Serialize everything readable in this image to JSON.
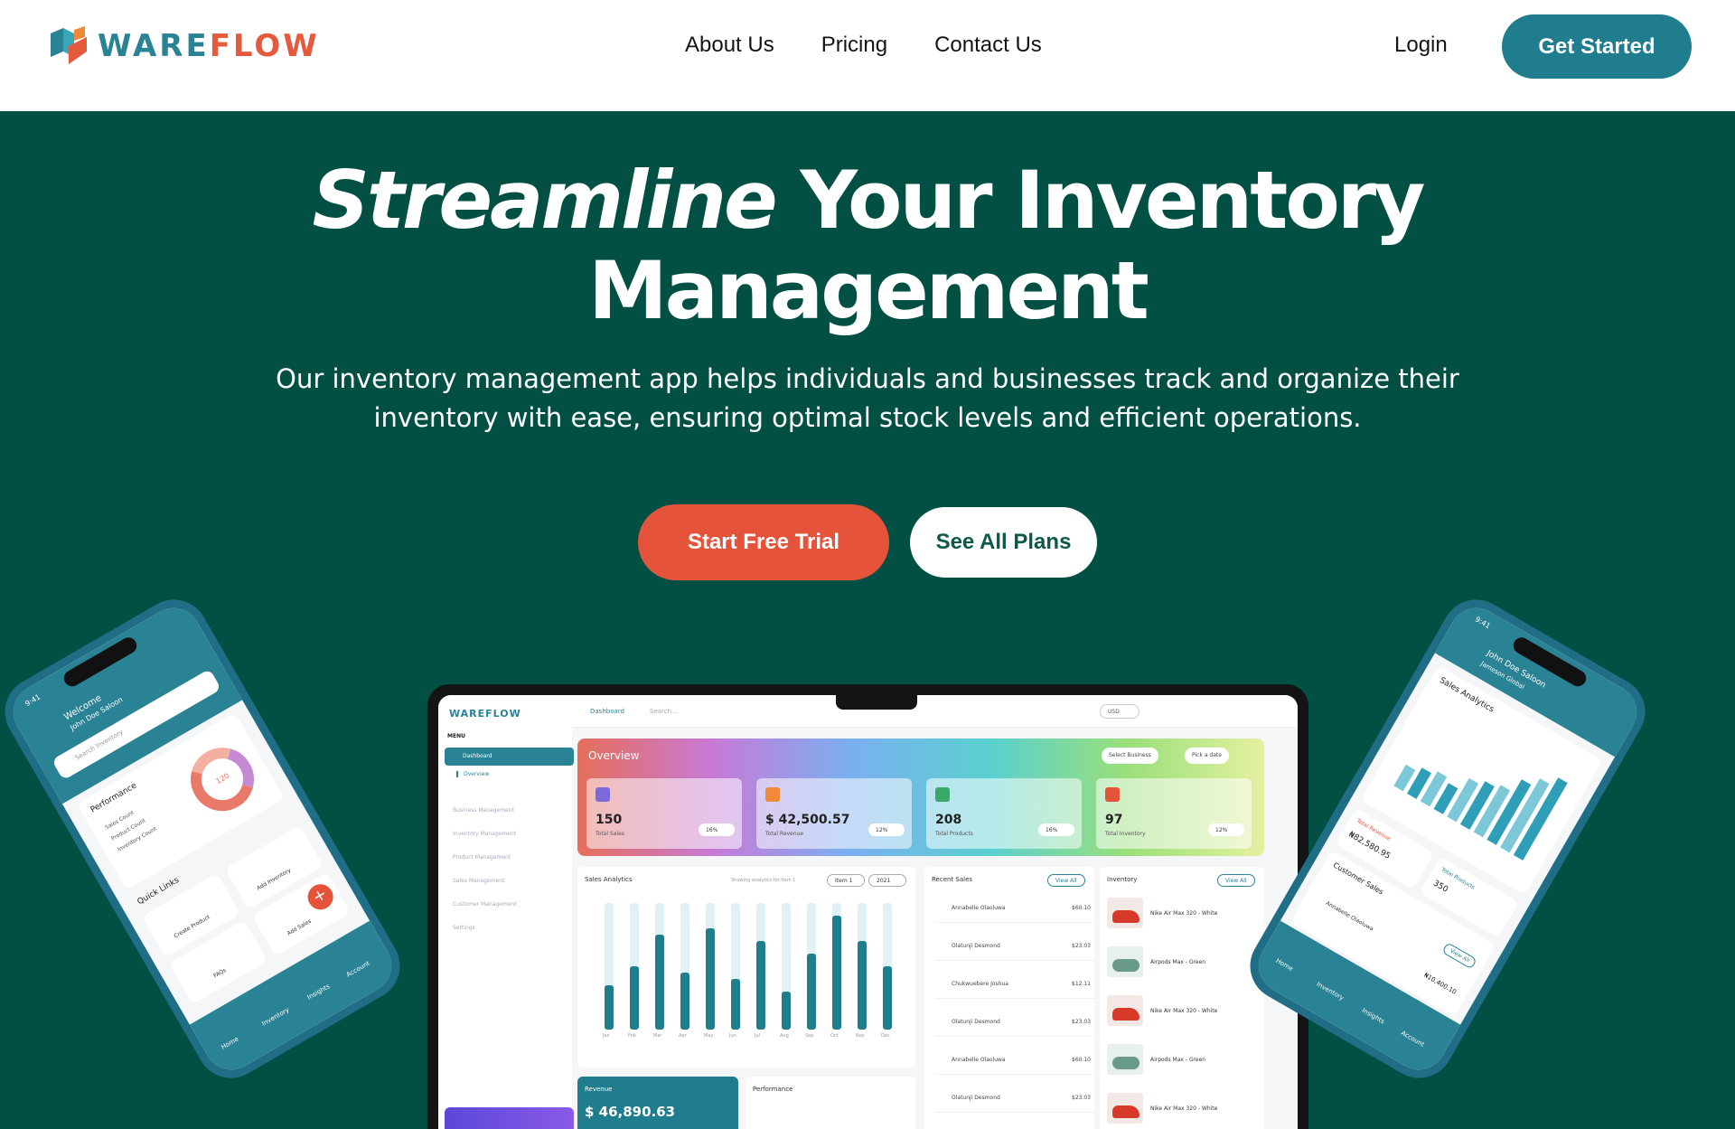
{
  "brand": {
    "part1": "WARE",
    "part2": "FLOW",
    "accent_teal": "#2a8295",
    "accent_orange": "#e55a3c"
  },
  "nav": {
    "links": [
      {
        "label": "About Us"
      },
      {
        "label": "Pricing"
      },
      {
        "label": "Contact Us"
      }
    ],
    "login": "Login",
    "cta": "Get Started"
  },
  "hero": {
    "title_italic": "Streamline",
    "title_rest": "Your Inventory",
    "title_line2": "Management",
    "subtitle": "Our inventory management app helps individuals and businesses track and organize their inventory with ease, ensuring optimal stock levels and efficient operations.",
    "primary_button": "Start Free Trial",
    "secondary_button": "See All Plans"
  },
  "dashboard": {
    "logo": "WAREFLOW",
    "menu_label": "MENU",
    "active_item": "Dashboard",
    "sub_item": "Overview",
    "sidebar_items": [
      "Business Management",
      "Inventory Management",
      "Product Management",
      "Sales Management",
      "Customer Management",
      "Settings"
    ],
    "breadcrumb": "Dashboard",
    "search_placeholder": "Search...",
    "currency": "USD",
    "overview_title": "Overview",
    "select_business": "Select Business",
    "pick_date": "Pick a date",
    "stats": [
      {
        "value": "150",
        "label": "Total Sales",
        "change": "16%",
        "color": "#7b6ad8"
      },
      {
        "value": "$ 42,500.57",
        "label": "Total Revenue",
        "change": "12%",
        "color": "#f08a3a"
      },
      {
        "value": "208",
        "label": "Total Products",
        "change": "16%",
        "color": "#3aa86a"
      },
      {
        "value": "97",
        "label": "Total Inventory",
        "change": "12%",
        "color": "#e5533a"
      }
    ],
    "sales_analytics_title": "Sales Analytics",
    "showing_analytics": "Showing analytics for Item 1",
    "item_select": "Item 1",
    "year_select": "2021",
    "months": [
      "Jan",
      "Feb",
      "Mar",
      "Apr",
      "May",
      "Jun",
      "Jul",
      "Aug",
      "Sep",
      "Oct",
      "Nov",
      "Dec"
    ],
    "bar_values": [
      0.35,
      0.5,
      0.75,
      0.45,
      0.8,
      0.4,
      0.7,
      0.3,
      0.6,
      0.9,
      0.7,
      0.5
    ],
    "recent_sales_title": "Recent Sales",
    "view_all": "View All",
    "recent_sales": [
      {
        "name": "Annabelle Olaoluwa",
        "amount": "$60.10"
      },
      {
        "name": "Olatunji Desmond",
        "amount": "$23.03"
      },
      {
        "name": "Chukwuebere Joshua",
        "amount": "$12.11"
      },
      {
        "name": "Olatunji Desmond",
        "amount": "$23.03"
      },
      {
        "name": "Annabelle Olaoluwa",
        "amount": "$60.10"
      },
      {
        "name": "Olatunji Desmond",
        "amount": "$23.03"
      }
    ],
    "inventory_title": "Inventory",
    "inventory": [
      {
        "name": "Nike Air Max 320 - White"
      },
      {
        "name": "Airpods Max - Green"
      },
      {
        "name": "Nike Air Max 320 - White"
      },
      {
        "name": "Airpods Max - Green"
      },
      {
        "name": "Nike Air Max 320 - White"
      }
    ],
    "revenue_title": "Revenue",
    "revenue_value": "$ 46,890.63",
    "performance_title": "Performance"
  },
  "phone_left": {
    "time": "9:41",
    "welcome": "Welcome",
    "user": "John Doe Saloon",
    "search_placeholder": "Search Inventory",
    "performance": "Performance",
    "legend": [
      "Sales Count",
      "Product Count",
      "Inventory Count"
    ],
    "donut_value": "120",
    "quick_links": "Quick Links",
    "links": [
      "Create Product",
      "Add Inventory",
      "FAQs",
      "Add Sales"
    ],
    "tabs": [
      "Home",
      "Inventory",
      "Insights",
      "Account"
    ]
  },
  "phone_right": {
    "time": "9:41",
    "user": "John Doe Saloon",
    "org": "Jameson Global",
    "sales_analytics": "Sales Analytics",
    "bar_values": [
      0.25,
      0.3,
      0.35,
      0.3,
      0.45,
      0.5,
      0.55,
      0.7,
      0.8,
      0.9
    ],
    "total_revenue_label": "Total Revenue",
    "total_revenue": "₦82,580.95",
    "total_products_label": "Total Products",
    "total_products": "350",
    "customer_sales": "Customer Sales",
    "view_all": "View All",
    "customer": "Annabelle Olaoluwa",
    "customer_amount": "₦10,400.10",
    "tabs": [
      "Home",
      "Inventory",
      "Insights",
      "Account"
    ]
  }
}
